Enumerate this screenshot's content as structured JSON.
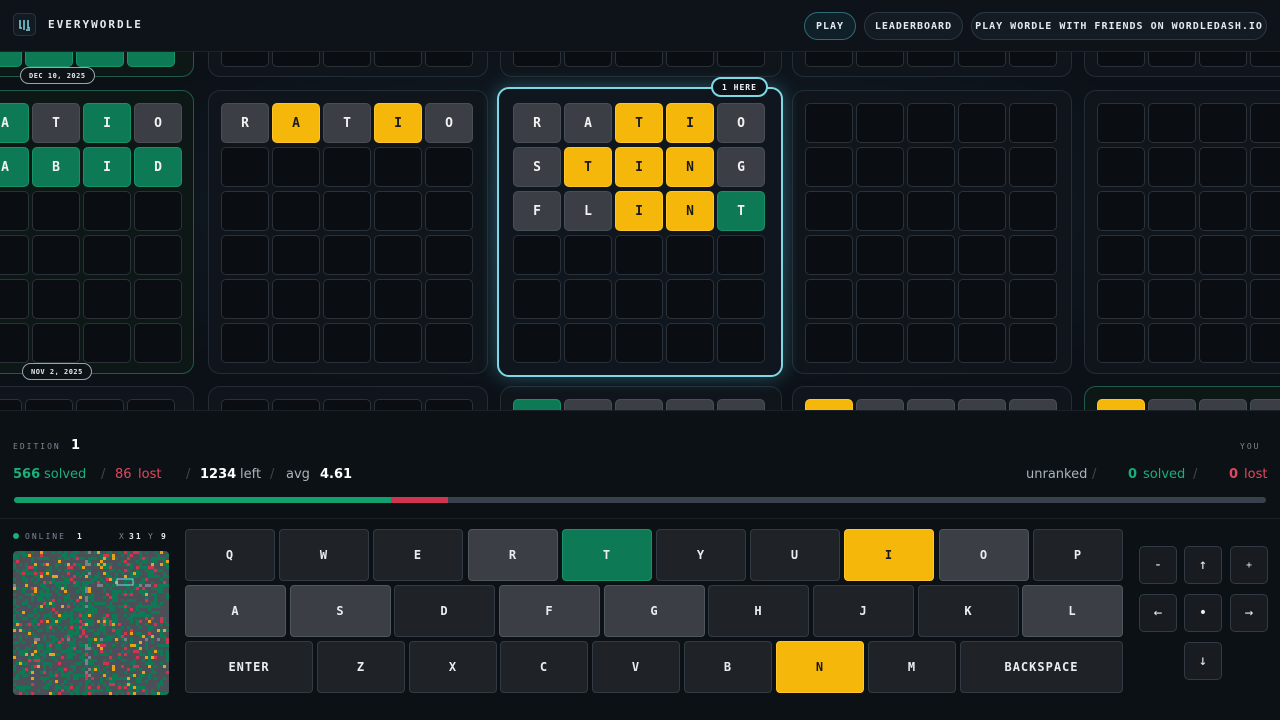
{
  "header": {
    "brand": "EVERYWORDLE",
    "play": "PLAY",
    "leaderboard": "LEADERBOARD",
    "promo": "PLAY WORDLE WITH FRIENDS ON WORDLEDASH.IO"
  },
  "boards": {
    "date_top": "DEC 10, 2025",
    "date_bottom": "NOV 2, 2025",
    "here": "1 HERE",
    "left": {
      "rows": [
        [
          "A",
          "T",
          "I",
          "O"
        ],
        [
          "A",
          "B",
          "I",
          "D"
        ]
      ],
      "states": [
        [
          "g",
          "x",
          "g",
          "x"
        ],
        [
          "g",
          "g",
          "g",
          "g"
        ]
      ]
    },
    "board2": {
      "row": [
        "R",
        "A",
        "T",
        "I",
        "O"
      ],
      "states": [
        "x",
        "y",
        "x",
        "y",
        "x"
      ]
    },
    "current": {
      "rows": [
        [
          "R",
          "A",
          "T",
          "I",
          "O"
        ],
        [
          "S",
          "T",
          "I",
          "N",
          "G"
        ],
        [
          "F",
          "L",
          "I",
          "N",
          "T"
        ]
      ],
      "states": [
        [
          "x",
          "x",
          "y",
          "y",
          "x"
        ],
        [
          "x",
          "y",
          "y",
          "y",
          "x"
        ],
        [
          "x",
          "x",
          "y",
          "y",
          "g"
        ]
      ]
    }
  },
  "stats": {
    "edition_label": "EDITION",
    "edition": "1",
    "you_label": "YOU",
    "solved_n": "566",
    "solved_t": "solved",
    "lost_n": "86",
    "lost_t": "lost",
    "left_n": "1234",
    "left_t": "left",
    "avg_t": "avg",
    "avg_n": "4.61",
    "rank": "unranked",
    "my_solved_n": "0",
    "my_solved_t": "solved",
    "my_lost_n": "0",
    "my_lost_t": "lost",
    "progress": {
      "solved_fraction": 0.301,
      "lost_fraction": 0.046
    }
  },
  "online": {
    "label": "ONLINE",
    "count": "1",
    "x_label": "X",
    "x": "31",
    "y_label": "Y",
    "y": "9"
  },
  "keyboard": {
    "row1": [
      "Q",
      "W",
      "E",
      "R",
      "T",
      "Y",
      "U",
      "I",
      "O",
      "P"
    ],
    "row1_states": [
      "",
      "",
      "",
      "x",
      "g",
      "",
      "",
      "y",
      "x",
      ""
    ],
    "row2": [
      "A",
      "S",
      "D",
      "F",
      "G",
      "H",
      "J",
      "K",
      "L"
    ],
    "row2_states": [
      "x",
      "x",
      "",
      "x",
      "x",
      "",
      "",
      "",
      "x"
    ],
    "row3": [
      "ENTER",
      "Z",
      "X",
      "C",
      "V",
      "B",
      "N",
      "M",
      "BACKSPACE"
    ],
    "row3_states": [
      "",
      "",
      "",
      "",
      "",
      "",
      "y",
      "",
      ""
    ]
  },
  "nav": {
    "minus": "-",
    "up": "↑",
    "plus": "+",
    "left": "←",
    "center": "•",
    "right": "→",
    "down": "↓"
  },
  "colors": {
    "green": "#0e7a55",
    "yellow": "#f6b70b",
    "red": "#d0344e",
    "accent": "#7fd8e6"
  }
}
